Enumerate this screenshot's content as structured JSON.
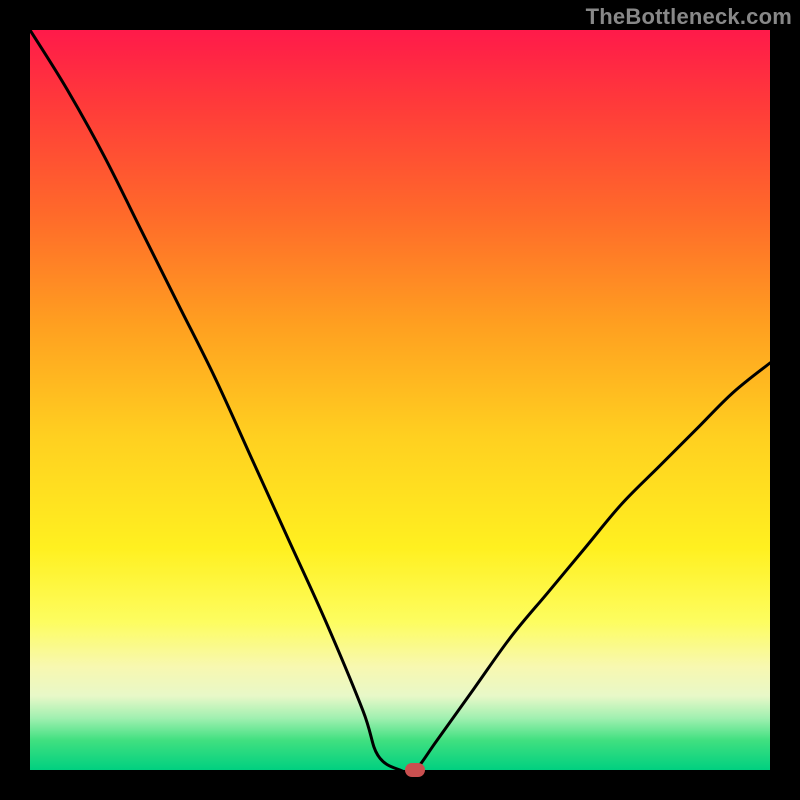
{
  "attribution": "TheBottleneck.com",
  "chart_data": {
    "type": "line",
    "title": "",
    "xlabel": "",
    "ylabel": "",
    "xlim": [
      0,
      100
    ],
    "ylim": [
      0,
      100
    ],
    "grid": false,
    "legend": false,
    "series": [
      {
        "name": "bottleneck-curve",
        "x": [
          0,
          5,
          10,
          15,
          20,
          25,
          30,
          35,
          40,
          45,
          47,
          50,
          52,
          55,
          60,
          65,
          70,
          75,
          80,
          85,
          90,
          95,
          100
        ],
        "values": [
          100,
          92,
          83,
          73,
          63,
          53,
          42,
          31,
          20,
          8,
          2,
          0,
          0,
          4,
          11,
          18,
          24,
          30,
          36,
          41,
          46,
          51,
          55
        ]
      }
    ],
    "marker": {
      "x": 52,
      "y": 0,
      "color": "#c94f4f"
    },
    "background_gradient": {
      "top": "#ff1a4a",
      "bottom": "#00d080"
    }
  }
}
